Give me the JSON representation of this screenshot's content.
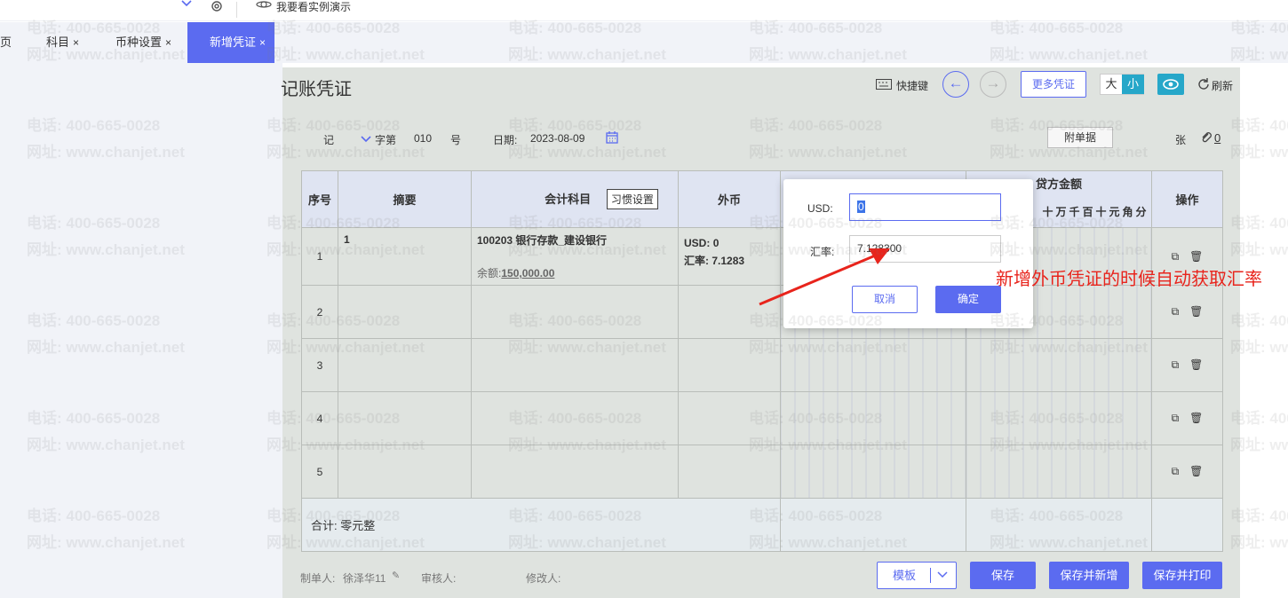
{
  "topbar": {
    "demo_label": "我要看实例演示"
  },
  "tabs": [
    {
      "label": "页"
    },
    {
      "label": "科目",
      "close": "×"
    },
    {
      "label": "币种设置",
      "close": "×"
    },
    {
      "label": "新增凭证",
      "close": "×"
    }
  ],
  "header": {
    "title": "记账凭证",
    "shortcut_label": "快捷键",
    "more_label": "更多凭证",
    "size_large": "大",
    "size_small": "小",
    "refresh_label": "刷新",
    "prev_icon": "←",
    "next_icon": "→"
  },
  "voucher": {
    "type": "记",
    "word_label": "字第",
    "number": "010",
    "number_suffix": "号",
    "date_label": "日期:",
    "date": "2023-08-09",
    "attach_label": "附单据",
    "sheets_label": "张",
    "attach_count": "0"
  },
  "table": {
    "headers": {
      "seq": "序号",
      "summary": "摘要",
      "account": "会计科目",
      "habit_btn": "习惯设置",
      "foreign": "外币",
      "credit": "贷方金额",
      "ops": "操作"
    },
    "digit_labels": [
      "十",
      "万",
      "千",
      "百",
      "十",
      "元",
      "角",
      "分"
    ],
    "rows": [
      {
        "num": "1",
        "summary": "1",
        "account": "100203 银行存款_建设银行",
        "balance_label": "余额:",
        "balance": "150,000.00",
        "fx_currency": "USD:",
        "fx_amount": "0",
        "fx_rate_label": "汇率:",
        "fx_rate": "7.1283"
      },
      {
        "num": "2"
      },
      {
        "num": "3"
      },
      {
        "num": "4"
      },
      {
        "num": "5"
      }
    ],
    "total_label": "合计:",
    "total_text": "零元整"
  },
  "popup": {
    "usd_label": "USD:",
    "usd_value": "0",
    "rate_label": "汇率:",
    "rate_value": "7.128300",
    "cancel_label": "取消",
    "ok_label": "确定"
  },
  "annotation": "新增外币凭证的时候自动获取汇率",
  "footer": {
    "maker_label": "制单人:",
    "maker_name": "徐泽华11",
    "reviewer_label": "审核人:",
    "modifier_label": "修改人:",
    "template_label": "模板",
    "save_label": "保存",
    "save_new_label": "保存并新增",
    "save_print_label": "保存并打印"
  },
  "watermark": {
    "phone": "电话: 400-665-0028",
    "site": "网址: www.chanjet.net"
  },
  "colors": {
    "accent": "#5b6bf0",
    "annotation": "#e8241c",
    "eye_btn": "#26a7c9"
  }
}
